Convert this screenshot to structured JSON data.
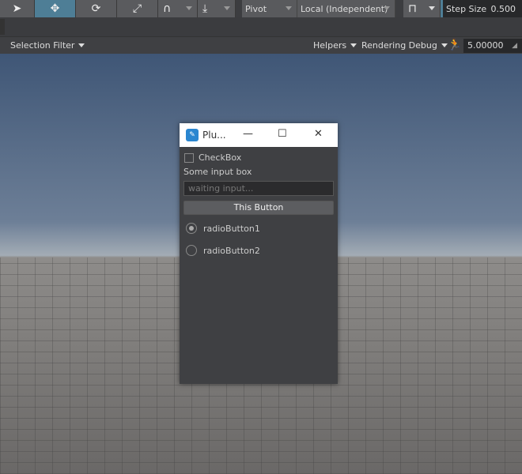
{
  "toolbar": {
    "tools": [
      {
        "name": "select-tool",
        "glyph": "➤"
      },
      {
        "name": "move-tool",
        "glyph": "✥"
      },
      {
        "name": "rotate-tool",
        "glyph": "⟳"
      },
      {
        "name": "scale-tool",
        "glyph": "⤢"
      },
      {
        "name": "snap-surface-tool",
        "glyph": "∩"
      },
      {
        "name": "snap-ground-tool",
        "glyph": "⤓"
      }
    ],
    "pivot": "Pivot",
    "space": "Local (Independent)",
    "step_size_label": "Step Size",
    "step_size_value": "0.500"
  },
  "viewport_bar": {
    "selection_filter": "Selection Filter",
    "helpers": "Helpers",
    "rendering_debug": "Rendering Debug",
    "speed_value": "5.00000"
  },
  "dialog": {
    "title": "Plu...",
    "checkbox_label": "CheckBox",
    "checkbox_checked": false,
    "input_label": "Some input box",
    "input_placeholder": "waiting input...",
    "button_label": "This Button",
    "radios": [
      {
        "label": "radioButton1",
        "checked": true
      },
      {
        "label": "radioButton2",
        "checked": false
      }
    ]
  },
  "colors": {
    "active_tool": "#4e7e96"
  }
}
